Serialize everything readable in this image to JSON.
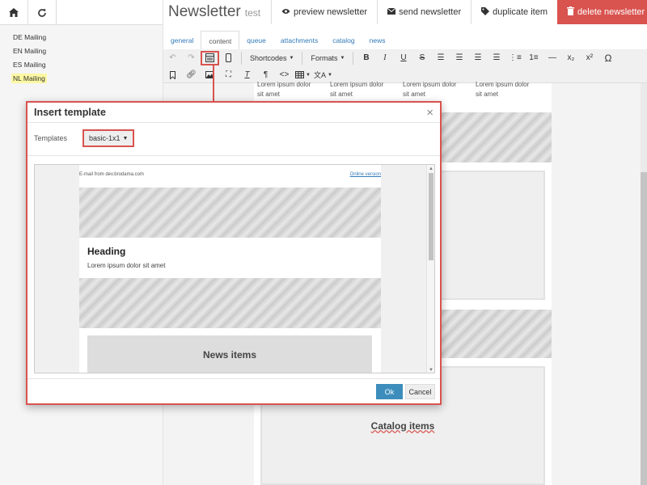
{
  "sidebar": {
    "items": [
      {
        "label": "DE Mailing"
      },
      {
        "label": "EN Mailing"
      },
      {
        "label": "ES Mailing"
      },
      {
        "label": "NL Mailing"
      }
    ],
    "active_color": "#fcf8a3"
  },
  "header": {
    "title": "Newsletter",
    "subtitle": "test"
  },
  "actions": {
    "preview": "preview newsletter",
    "send": "send newsletter",
    "duplicate": "duplicate item",
    "delete": "delete newsletter",
    "delete_color": "#d9534f"
  },
  "tabs": [
    "general",
    "content",
    "queue",
    "attachments",
    "catalog",
    "news"
  ],
  "toolbar": {
    "shortcodes": "Shortcodes",
    "formats": "Formats"
  },
  "editor": {
    "lorem_text": "Lorem ipsum dolor sit amet",
    "catalog_label": "Catalog items"
  },
  "modal": {
    "title": "Insert template",
    "templates_label": "Templates",
    "selected_template": "basic-1x1",
    "preview": {
      "from_text": "E-mail from dev.brodama.com",
      "online_link": "Online version",
      "heading": "Heading",
      "lorem": "Lorem ipsum dolor sit amet",
      "news_label": "News items"
    },
    "ok_label": "Ok",
    "cancel_label": "Cancel",
    "highlight_color": "#d9534f",
    "ok_color": "#3c8dbc"
  }
}
